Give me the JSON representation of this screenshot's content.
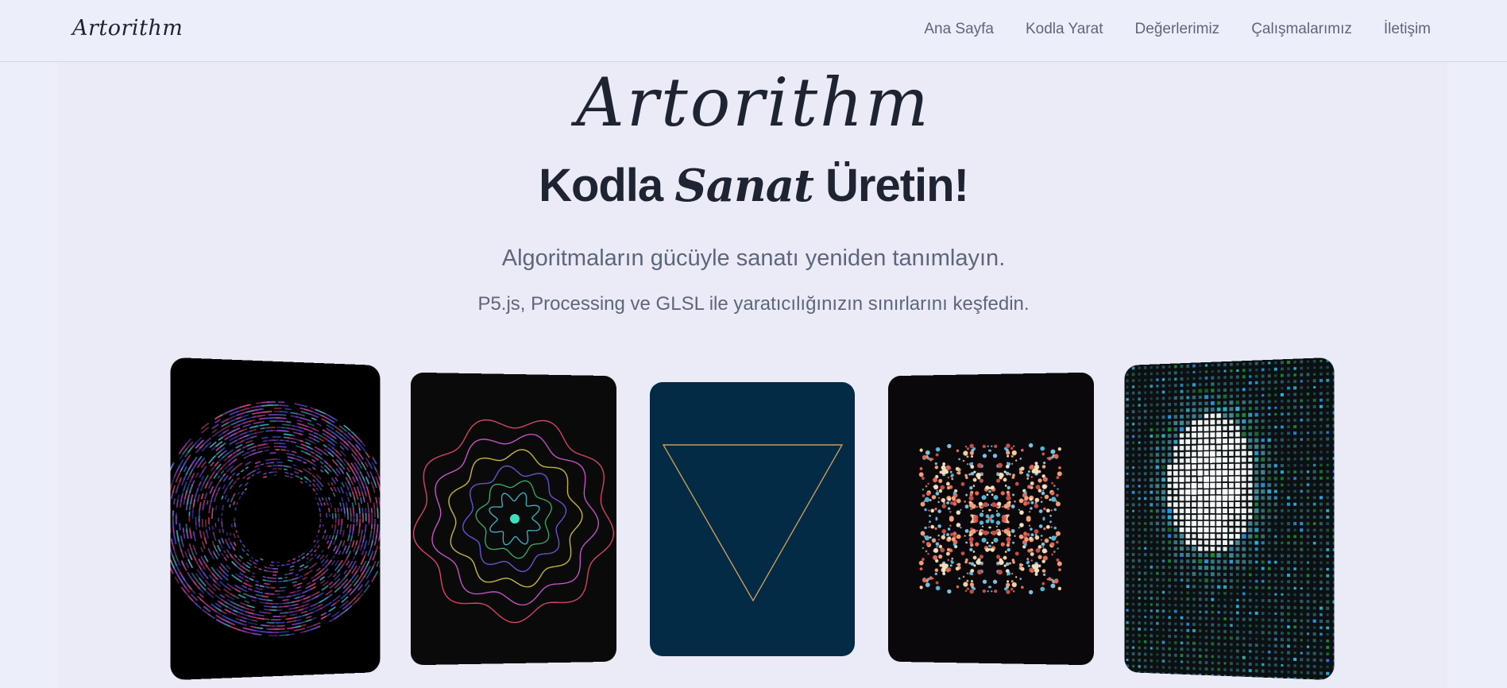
{
  "header": {
    "brand": "Artorithm",
    "nav": [
      "Ana Sayfa",
      "Kodla Yarat",
      "Değerlerimiz",
      "Çalışmalarımız",
      "İletişim"
    ]
  },
  "hero": {
    "logo": "Artorithm",
    "headline_part1": "Kodla",
    "headline_accent": "Sanat",
    "headline_part2": "Üretin!",
    "subtitle": "Algoritmaların gücüyle sanatı yeniden tanımlayın.",
    "tagline": "P5.js, Processing ve GLSL ile yaratıcılığınızın sınırlarını keşfedin."
  },
  "gallery": {
    "cards": [
      {
        "icon": "ring-particles-art",
        "bg": "#000000"
      },
      {
        "icon": "wavy-rings-art",
        "bg": "#0a0a0a"
      },
      {
        "icon": "triangle-art",
        "bg": "#032b46",
        "stroke": "#c99a5a"
      },
      {
        "icon": "kaleidoscope-dots-art",
        "bg": "#0a080b"
      },
      {
        "icon": "pixel-grid-art",
        "bg": "#0b1012"
      }
    ]
  },
  "colors": {
    "background": "#eceef9",
    "text": "#1f2433",
    "muted": "#5d667a"
  }
}
